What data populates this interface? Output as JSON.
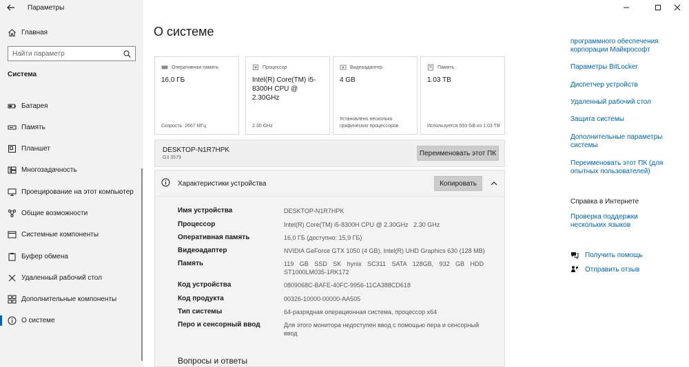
{
  "window": {
    "title": "Параметры",
    "controls": {
      "minimize": "—",
      "maximize": "□",
      "close": "✕"
    }
  },
  "sidebar": {
    "home_label": "Главная",
    "search_placeholder": "Найти параметр",
    "section_title": "Система",
    "items": [
      {
        "label": "Батарея",
        "icon": "battery-icon"
      },
      {
        "label": "Память",
        "icon": "storage-icon"
      },
      {
        "label": "Планшет",
        "icon": "tablet-icon"
      },
      {
        "label": "Многозадачность",
        "icon": "multitasking-icon"
      },
      {
        "label": "Проецирование на этот компьютер",
        "icon": "projecting-icon"
      },
      {
        "label": "Общие возможности",
        "icon": "shared-experiences-icon"
      },
      {
        "label": "Системные компоненты",
        "icon": "system-components-icon"
      },
      {
        "label": "Буфер обмена",
        "icon": "clipboard-icon"
      },
      {
        "label": "Удаленный рабочий стол",
        "icon": "remote-desktop-icon"
      },
      {
        "label": "Дополнительные компоненты",
        "icon": "optional-features-icon"
      },
      {
        "label": "О системе",
        "icon": "about-icon",
        "active": true
      }
    ]
  },
  "main": {
    "title": "О системе",
    "cards": [
      {
        "label": "Оперативная память",
        "value": "16,0 ГБ",
        "footer": "Скорость: 2667 МГц"
      },
      {
        "label": "Процессор",
        "value": "Intel(R) Core(TM) i5-8300H CPU @ 2.30GHz",
        "footer": "2.30 GHz"
      },
      {
        "label": "Видеоадаптер",
        "value": "4 GB",
        "footer": "Установлено несколько графических процессоров"
      },
      {
        "label": "Память",
        "value": "1.03 TB",
        "footer": "Используется 593 GB из 1.03 TB"
      }
    ],
    "device": {
      "name": "DESKTOP-N1R7HPK",
      "model": "G3 3579",
      "rename_button": "Переименовать этот ПК"
    },
    "specs": {
      "title": "Характеристики устройства",
      "copy_button": "Копировать",
      "rows": [
        {
          "key": "Имя устройства",
          "value": "DESKTOP-N1R7HPK"
        },
        {
          "key": "Процессор",
          "value": "Intel(R) Core(TM) i5-8300H CPU @ 2.30GHz   2.30 GHz"
        },
        {
          "key": "Оперативная память",
          "value": "16,0 ГБ (доступно: 15,9 ГБ)"
        },
        {
          "key": "Видеоадаптер",
          "value": "NVIDIA GeForce GTX 1050 (4 GB), Intel(R) UHD Graphics 630 (128 MB)"
        },
        {
          "key": "Память",
          "value": "119 GB SSD SK hynix SC311 SATA 128GB, 932 GB HDD ST1000LM035-1RK172"
        },
        {
          "key": "Код устройства",
          "value": "0809068C-BAFE-40FC-9956-11CA388CD618"
        },
        {
          "key": "Код продукта",
          "value": "00326-10000-00000-AA505"
        },
        {
          "key": "Тип системы",
          "value": "64-разрядная операционная система, процессор x64"
        },
        {
          "key": "Перо и сенсорный ввод",
          "value": "Для этого монитора недоступен ввод с помощью пера и сенсорный ввод"
        }
      ]
    },
    "faq_title": "Вопросы и ответы"
  },
  "right": {
    "links": [
      "программного обеспечения корпорации Майкрософт",
      "Параметры BitLocker",
      "Диспетчер устройств",
      "Удаленный рабочий стол",
      "Защита системы",
      "Дополнительные параметры системы",
      "Переименовать этот ПК (для опытных пользователей)"
    ],
    "help_heading": "Справка в Интернете",
    "help_link": "Проверка поддержки нескольких языков",
    "get_help": "Получить помощь",
    "send_feedback": "Отправить отзыв"
  },
  "colors": {
    "accent": "#0063b1",
    "sidebar_bg": "#f2f2f2",
    "button_bg": "#cccccc",
    "panel_bg": "#f3f3f3"
  }
}
